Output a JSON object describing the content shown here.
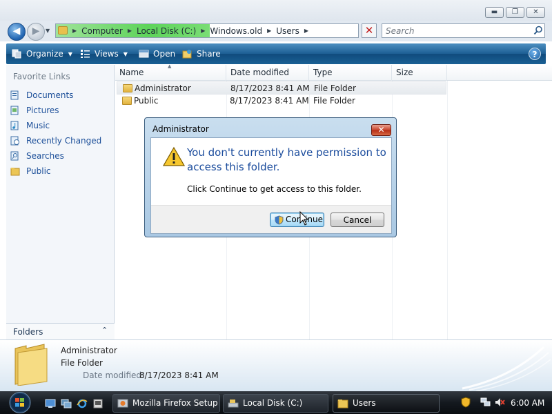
{
  "window": {
    "caption_buttons": {
      "minimize": "▬",
      "maximize": "❐",
      "close": "✕"
    }
  },
  "address": {
    "crumbs": [
      "Computer",
      "Local Disk (C:)",
      "Windows.old",
      "Users"
    ],
    "search_placeholder": "Search",
    "refresh_glyph": "✕"
  },
  "toolbar": {
    "organize": "Organize",
    "views": "Views",
    "open": "Open",
    "share": "Share",
    "help": "?"
  },
  "nav": {
    "favorite_links_title": "Favorite Links",
    "items": [
      {
        "label": "Documents",
        "icon": "documents-icon"
      },
      {
        "label": "Pictures",
        "icon": "pictures-icon"
      },
      {
        "label": "Music",
        "icon": "music-icon"
      },
      {
        "label": "Recently Changed",
        "icon": "recently-changed-icon"
      },
      {
        "label": "Searches",
        "icon": "searches-icon"
      },
      {
        "label": "Public",
        "icon": "folder-icon"
      }
    ],
    "folders_label": "Folders"
  },
  "filelist": {
    "columns": [
      "Name",
      "Date modified",
      "Type",
      "Size"
    ],
    "rows": [
      {
        "name": "Administrator",
        "date": "8/17/2023 8:41 AM",
        "type": "File Folder",
        "selected": true
      },
      {
        "name": "Public",
        "date": "8/17/2023 8:41 AM",
        "type": "File Folder",
        "selected": false
      }
    ]
  },
  "details": {
    "name": "Administrator",
    "type": "File Folder",
    "date_label": "Date modified:",
    "date_value": "8/17/2023 8:41 AM"
  },
  "dialog": {
    "title": "Administrator",
    "close_glyph": "✕",
    "heading": "You don't currently have permission to access this folder.",
    "message": "Click Continue to get access to this folder.",
    "continue_label": "Continue",
    "cancel_label": "Cancel"
  },
  "taskbar": {
    "tasks": [
      "Mozilla Firefox Setup",
      "Local Disk (C:)",
      "Users"
    ],
    "clock": "6:00 AM"
  },
  "colors": {
    "accent": "#1c5e93",
    "link": "#1c4f99",
    "dialog_heading": "#1a4b9c",
    "address_highlight": "#5ed45a"
  }
}
